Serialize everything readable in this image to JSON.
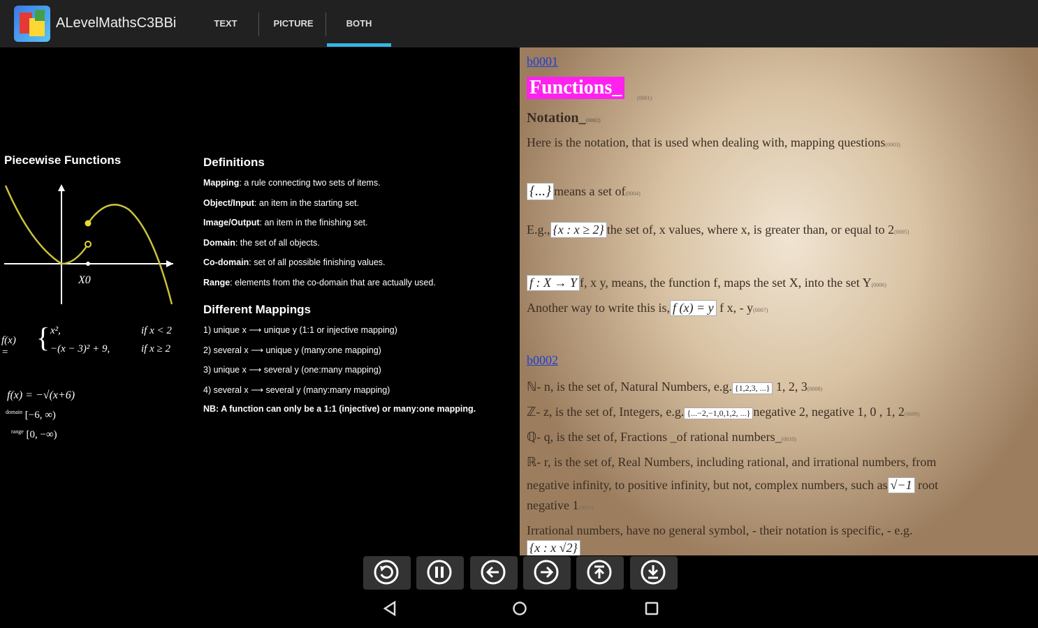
{
  "app": {
    "title": "ALevelMathsC3BBi"
  },
  "tabs": [
    {
      "label": "TEXT",
      "selected": false
    },
    {
      "label": "PICTURE",
      "selected": false
    },
    {
      "label": "BOTH",
      "selected": true
    }
  ],
  "colors": {
    "accent": "#33b5e5",
    "highlight": "#ff22ee",
    "link": "#1f3fd6"
  },
  "left": {
    "piecewise_title": "Piecewise Functions",
    "graph_label": "X0",
    "piecewise_eq_lhs": "f(x) =",
    "piecewise_case1": "x²,",
    "piecewise_cond1": "if x < 2",
    "piecewise_case2": "−(x − 3)² + 9,",
    "piecewise_cond2": "if x ≥ 2",
    "sqrt_eq": "f(x) = −√(x+6)",
    "domain_label": "domain",
    "domain_value": "[−6, ∞)",
    "range_label": "range",
    "range_value": "[0, −∞)",
    "definitions_title": "Definitions",
    "definitions": [
      {
        "term": "Mapping",
        "desc": ": a rule connecting two sets of items."
      },
      {
        "term": "Object/Input",
        "desc": ": an item in the starting set."
      },
      {
        "term": "Image/Output",
        "desc": ": an item in the finishing set."
      },
      {
        "term": "Domain",
        "desc": ": the set of all objects."
      },
      {
        "term": "Co-domain",
        "desc": ": set of all possible finishing values."
      },
      {
        "term": "Range",
        "desc": ": elements from the co-domain that are actually used."
      }
    ],
    "mappings_title": "Different Mappings",
    "mappings": [
      "1) unique x ⟶ unique y (1:1 or injective mapping)",
      "2) several x ⟶ unique y (many:one mapping)",
      "3) unique x ⟶ several y (one:many mapping)",
      "4) several x ⟶ several y (many:many mapping)"
    ],
    "nb": "NB: A function can only be a 1:1 (injective) or many:one mapping."
  },
  "right": {
    "link1": "b0001",
    "heading": "Functions_",
    "heading_code": "(0001)",
    "notation": "Notation_",
    "notation_code": "(0002)",
    "intro": "Here is the notation, that is used when dealing with, mapping questions",
    "intro_code": "(0003)",
    "set_box": "{...}",
    "set_text": "means a set of",
    "set_code": "(0004)",
    "eg_prefix": "E.g.,",
    "eg_box": "{x : x ≥ 2}",
    "eg_text": "the set of, x values, where x, is greater than, or equal to 2",
    "eg_code": "(0005)",
    "map_box": "f : X → Y",
    "map_text": "f, x y, means, the function f, maps the set X, into the set Y",
    "map_code": "(0006)",
    "another_text": "Another way to write this is,",
    "another_box": "f (x) = y",
    "another_tail": "f x, - y",
    "another_code": "(0007)",
    "link2": "b0002",
    "n_text": "- n, is the set of, Natural Numbers, e.g.",
    "n_box": "{1,2,3, ...}",
    "n_tail": "1, 2, 3",
    "n_code": "(0008)",
    "z_text": "- z, is the set of, Integers, e.g.",
    "z_box": "{...−2,−1,0,1,2, ...}",
    "z_tail": "negative 2, negative 1, 0 , 1, 2",
    "z_code": "(0009)",
    "q_text": "- q, is the set of, Fractions _of rational numbers_",
    "q_code": "(0010)",
    "r_text": "- r, is the set of, Real Numbers, including rational, and irrational numbers, from",
    "r_text2": "negative infinity, to positive infinity, but not, complex numbers, such as",
    "r_box": "√−1",
    "r_tail": "root",
    "r_text3": "negative 1",
    "r_code": "(0011)",
    "irr_text": "Irrational numbers, have no general symbol, - their notation is specific, - e.g.",
    "irr_box": "{x : x √2}"
  },
  "controls": [
    {
      "icon": "refresh-icon"
    },
    {
      "icon": "pause-icon"
    },
    {
      "icon": "arrow-left-icon"
    },
    {
      "icon": "arrow-right-icon"
    },
    {
      "icon": "jump-top-icon"
    },
    {
      "icon": "download-icon"
    }
  ],
  "nav": [
    {
      "icon": "back-icon"
    },
    {
      "icon": "home-icon"
    },
    {
      "icon": "recents-icon"
    }
  ]
}
